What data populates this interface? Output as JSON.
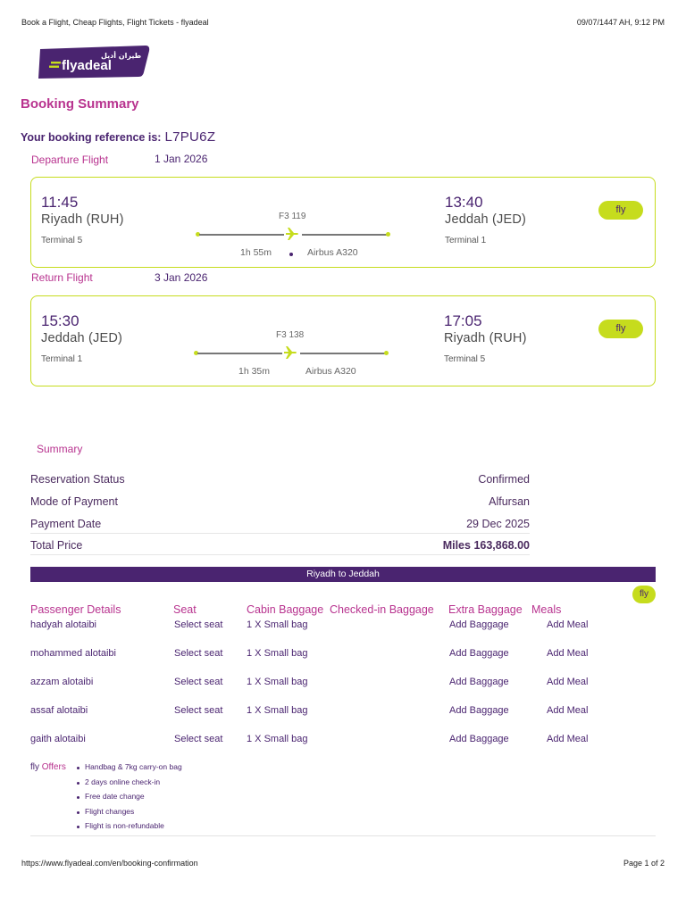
{
  "print": {
    "title": "Book a Flight, Cheap Flights, Flight Tickets - flyadeal",
    "datetime": "09/07/1447 AH, 9:12 PM",
    "url": "https://www.flyadeal.com/en/booking-confirmation",
    "page": "Page 1 of 2"
  },
  "logo": {
    "brand": "flyadeal",
    "arabic": "طيران أديل"
  },
  "page_title": "Booking Summary",
  "reference": {
    "label": "Your booking reference is:",
    "code": "L7PU6Z"
  },
  "flights": {
    "departure": {
      "label": "Departure Flight",
      "date": "1 Jan 2026",
      "dep_time": "11:45",
      "dep_city": "Riyadh (RUH)",
      "dep_terminal": "Terminal 5",
      "arr_time": "13:40",
      "arr_city": "Jeddah (JED)",
      "arr_terminal": "Terminal 1",
      "flight_no": "F3 119",
      "duration": "1h 55m",
      "aircraft": "Airbus A320",
      "fare": "fly"
    },
    "return": {
      "label": "Return Flight",
      "date": "3 Jan 2026",
      "dep_time": "15:30",
      "dep_city": "Jeddah (JED)",
      "dep_terminal": "Terminal 1",
      "arr_time": "17:05",
      "arr_city": "Riyadh (RUH)",
      "arr_terminal": "Terminal 5",
      "flight_no": "F3 138",
      "duration": "1h 35m",
      "aircraft": "Airbus A320",
      "fare": "fly"
    }
  },
  "summary": {
    "title": "Summary",
    "rows": [
      {
        "label": "Reservation Status",
        "value": "Confirmed"
      },
      {
        "label": "Mode of Payment",
        "value": "Alfursan"
      },
      {
        "label": "Payment Date",
        "value": "29 Dec 2025"
      },
      {
        "label": "Total Price",
        "value": "Miles 163,868.00"
      }
    ]
  },
  "segment": {
    "route": "Riyadh to Jeddah",
    "fare": "fly",
    "headers": [
      "Passenger Details",
      "Seat",
      "Cabin Baggage",
      "Checked-in Baggage",
      "Extra Baggage",
      "Meals"
    ],
    "passengers": [
      {
        "name": "hadyah alotaibi",
        "seat": "Select seat",
        "cabin": "1 X Small bag",
        "extra": "Add Baggage",
        "meal": "Add Meal"
      },
      {
        "name": "mohammed alotaibi",
        "seat": "Select seat",
        "cabin": "1 X Small bag",
        "extra": "Add Baggage",
        "meal": "Add Meal"
      },
      {
        "name": "azzam alotaibi",
        "seat": "Select seat",
        "cabin": "1 X Small bag",
        "extra": "Add Baggage",
        "meal": "Add Meal"
      },
      {
        "name": "assaf alotaibi",
        "seat": "Select seat",
        "cabin": "1 X Small bag",
        "extra": "Add Baggage",
        "meal": "Add Meal"
      },
      {
        "name": "gaith alotaibi",
        "seat": "Select seat",
        "cabin": "1 X Small bag",
        "extra": "Add Baggage",
        "meal": "Add Meal"
      }
    ]
  },
  "offers": {
    "fare": "fly",
    "label": "Offers",
    "items": [
      "Handbag & 7kg carry-on bag",
      "2 days online check-in",
      "Free date change",
      "Flight changes",
      "Flight is non-refundable"
    ]
  },
  "colors": {
    "purple": "#4a2470",
    "magenta": "#b8338f",
    "lime": "#c6dc1d"
  }
}
